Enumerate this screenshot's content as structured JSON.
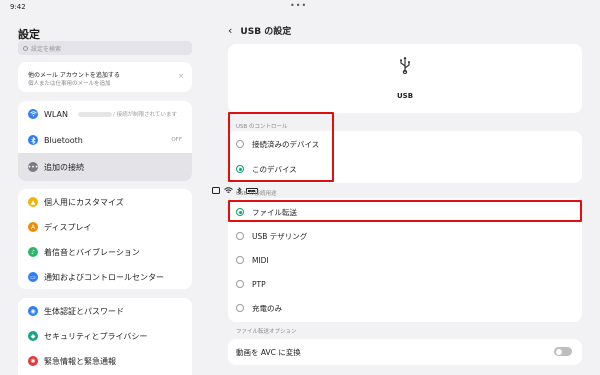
{
  "status_bar": {
    "time": "9:42",
    "dots": "•••",
    "battery": "■"
  },
  "left": {
    "title": "設定",
    "search_placeholder": "設定を検索",
    "promo": {
      "line1": "他のメール アカウントを追加する",
      "line2": "個人または仕事用のメールを追加",
      "close": "×"
    },
    "group1": [
      {
        "icon": "wifi-icon",
        "color": "#2d7ff9",
        "label": "WLAN",
        "value": "/ 接続が制限されています"
      },
      {
        "icon": "bluetooth-icon",
        "color": "#2d7ff9",
        "label": "Bluetooth",
        "value": "OFF"
      },
      {
        "icon": "more-connections-icon",
        "color": "#7a7a85",
        "label": "追加の接続",
        "value": ""
      }
    ],
    "group2": [
      {
        "icon": "personalize-icon",
        "color": "#f2b400",
        "label": "個人用にカスタマイズ"
      },
      {
        "icon": "display-icon",
        "color": "#f28a00",
        "label": "ディスプレイ"
      },
      {
        "icon": "sound-vibration-icon",
        "color": "#2fb56a",
        "label": "着信音とバイブレーション"
      },
      {
        "icon": "notification-control-icon",
        "color": "#2d7ff9",
        "label": "通知およびコントロールセンター"
      }
    ],
    "group3": [
      {
        "icon": "biometrics-password-icon",
        "color": "#2d7ff9",
        "label": "生体認証とパスワード"
      },
      {
        "icon": "security-privacy-icon",
        "color": "#1aa38a",
        "label": "セキュリティとプライバシー"
      },
      {
        "icon": "emergency-icon",
        "color": "#e23a3a",
        "label": "緊急情報と緊急通報"
      }
    ]
  },
  "right": {
    "title": "USB の設定",
    "usb_label": "USB",
    "section_control": "USB のコントロール",
    "control_options": [
      {
        "label": "接続済みのデバイス",
        "selected": false
      },
      {
        "label": "このデバイス",
        "selected": true
      }
    ],
    "section_mode": "USB の接続用途",
    "mode_options": [
      {
        "label": "ファイル転送",
        "selected": true
      },
      {
        "label": "USB テザリング",
        "selected": false
      },
      {
        "label": "MIDI",
        "selected": false
      },
      {
        "label": "PTP",
        "selected": false
      },
      {
        "label": "充電のみ",
        "selected": false
      }
    ],
    "section_transfer": "ファイル転送オプション",
    "convert_label": "動画を AVC に変換",
    "convert_on": false
  },
  "highlight_color": "#e01010",
  "accent_color": "#12a36b"
}
